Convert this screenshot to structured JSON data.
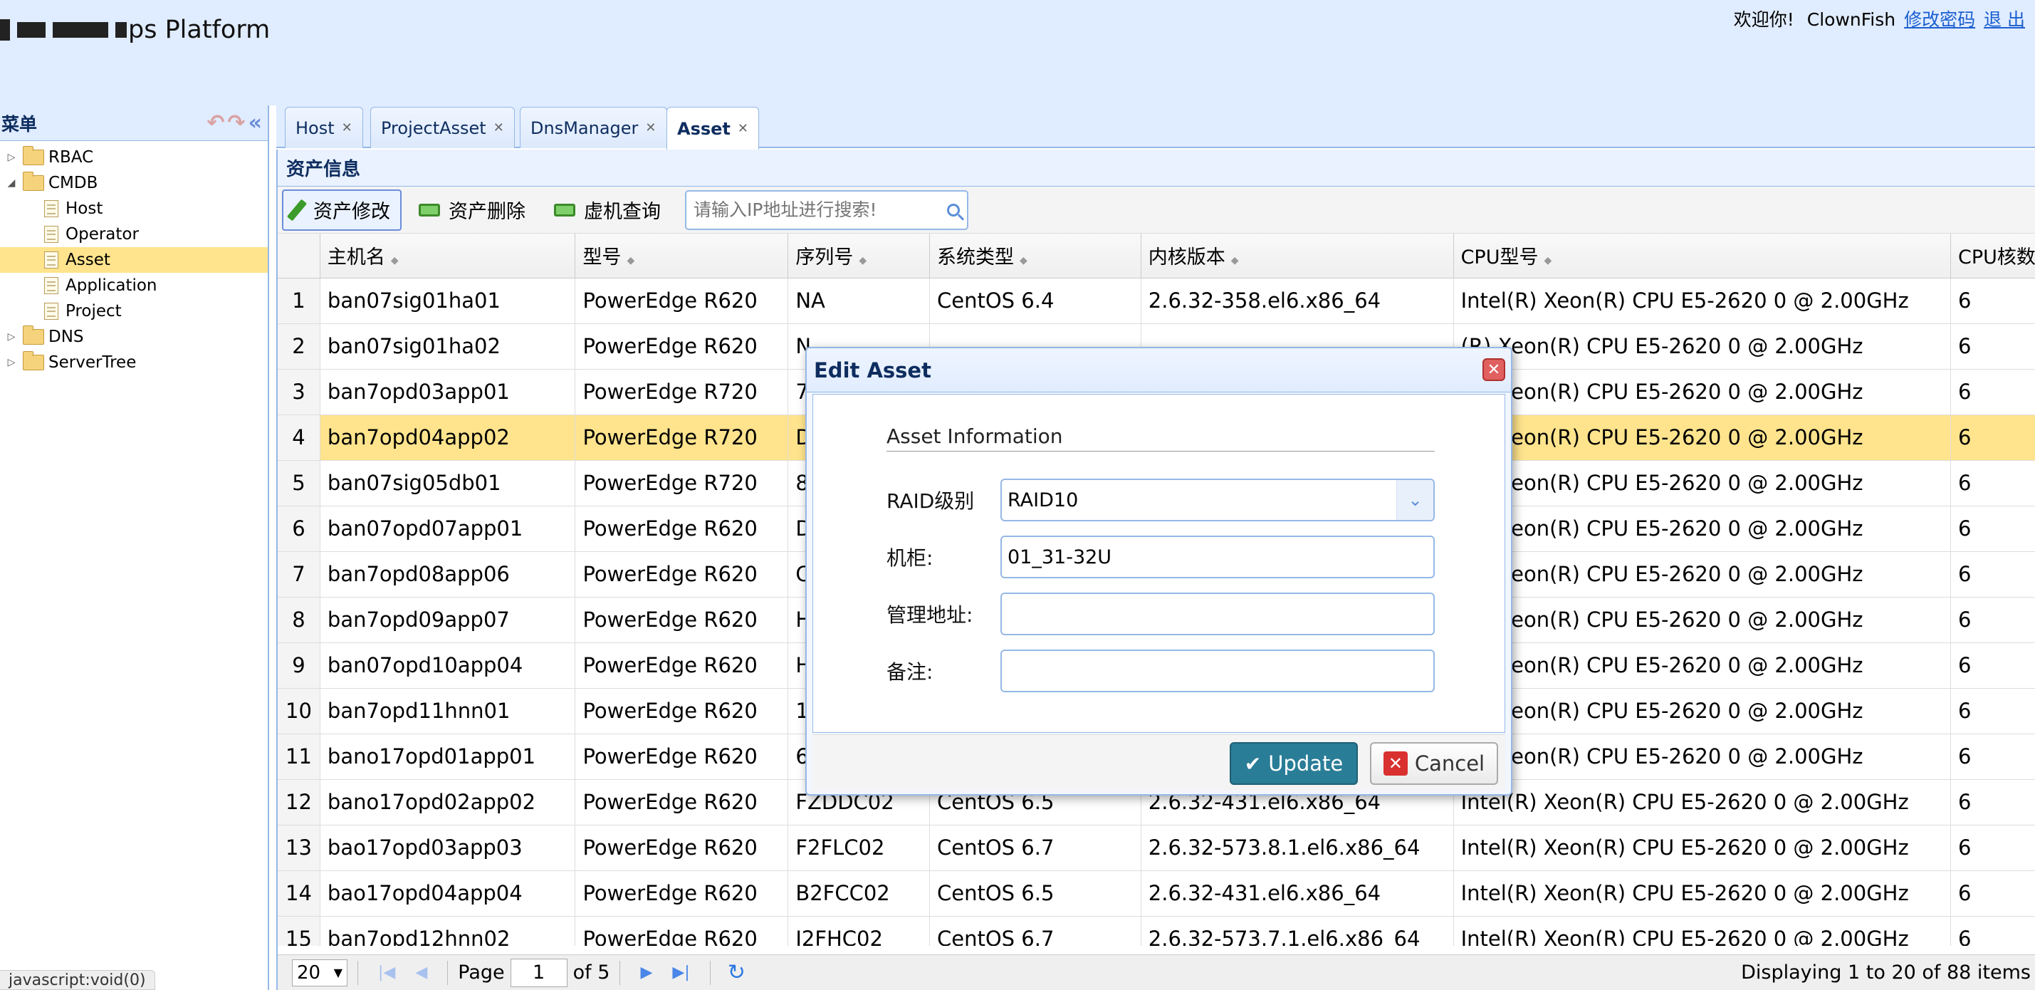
{
  "header": {
    "logo_visible": "ps Platform",
    "welcome": "欢迎你!",
    "username": "ClownFish",
    "change_password": "修改密码",
    "logout": "退 出"
  },
  "menu": {
    "title": "菜单",
    "tree": [
      {
        "label": "RBAC",
        "type": "folder",
        "expanded": false,
        "level": 0
      },
      {
        "label": "CMDB",
        "type": "folder",
        "expanded": true,
        "level": 0
      },
      {
        "label": "Host",
        "type": "file",
        "level": 1
      },
      {
        "label": "Operator",
        "type": "file",
        "level": 1
      },
      {
        "label": "Asset",
        "type": "file",
        "level": 1,
        "selected": true
      },
      {
        "label": "Application",
        "type": "file",
        "level": 1
      },
      {
        "label": "Project",
        "type": "file",
        "level": 1
      },
      {
        "label": "DNS",
        "type": "folder",
        "expanded": false,
        "level": 0
      },
      {
        "label": "ServerTree",
        "type": "folder",
        "expanded": false,
        "level": 0
      }
    ]
  },
  "tabs": [
    {
      "label": "Host",
      "active": false
    },
    {
      "label": "ProjectAsset",
      "active": false
    },
    {
      "label": "DnsManager",
      "active": false
    },
    {
      "label": "Asset",
      "active": true
    }
  ],
  "panel": {
    "title": "资产信息"
  },
  "toolbar": {
    "edit": "资产修改",
    "delete": "资产删除",
    "vm_query": "虚机查询",
    "search_placeholder": "请输入IP地址进行搜索!"
  },
  "table": {
    "columns": [
      "主机名",
      "型号",
      "序列号",
      "系统类型",
      "内核版本",
      "CPU型号",
      "CPU核数"
    ],
    "rows": [
      [
        "1",
        "ban07sig01ha01",
        "PowerEdge R620",
        "NA",
        "CentOS 6.4",
        "2.6.32-358.el6.x86_64",
        "Intel(R) Xeon(R) CPU E5-2620 0 @ 2.00GHz",
        "6"
      ],
      [
        "2",
        "ban07sig01ha02",
        "PowerEdge R620",
        "N",
        "",
        "",
        "(R) Xeon(R) CPU E5-2620 0 @ 2.00GHz",
        "6"
      ],
      [
        "3",
        "ban7opd03app01",
        "PowerEdge R720",
        "7",
        "",
        "",
        "(R) Xeon(R) CPU E5-2620 0 @ 2.00GHz",
        "6"
      ],
      [
        "4",
        "ban7opd04app02",
        "PowerEdge R720",
        "D",
        "",
        "",
        "(R) Xeon(R) CPU E5-2620 0 @ 2.00GHz",
        "6"
      ],
      [
        "5",
        "ban07sig05db01",
        "PowerEdge R720",
        "8",
        "",
        "",
        "(R) Xeon(R) CPU E5-2620 0 @ 2.00GHz",
        "6"
      ],
      [
        "6",
        "ban07opd07app01",
        "PowerEdge R620",
        "D",
        "",
        "",
        "(R) Xeon(R) CPU E5-2620 0 @ 2.00GHz",
        "6"
      ],
      [
        "7",
        "ban7opd08app06",
        "PowerEdge R620",
        "C",
        "",
        "",
        "(R) Xeon(R) CPU E5-2620 0 @ 2.00GHz",
        "6"
      ],
      [
        "8",
        "ban7opd09app07",
        "PowerEdge R620",
        "H",
        "",
        "",
        "(R) Xeon(R) CPU E5-2620 0 @ 2.00GHz",
        "6"
      ],
      [
        "9",
        "ban07opd10app04",
        "PowerEdge R620",
        "H",
        "",
        "",
        "(R) Xeon(R) CPU E5-2620 0 @ 2.00GHz",
        "6"
      ],
      [
        "10",
        "ban7opd11hnn01",
        "PowerEdge R620",
        "1",
        "",
        "",
        "(R) Xeon(R) CPU E5-2620 0 @ 2.00GHz",
        "6"
      ],
      [
        "11",
        "bano17opd01app01",
        "PowerEdge R620",
        "6",
        "",
        "",
        "(R) Xeon(R) CPU E5-2620 0 @ 2.00GHz",
        "6"
      ],
      [
        "12",
        "bano17opd02app02",
        "PowerEdge R620",
        "FZDDC02",
        "CentOS 6.5",
        "2.6.32-431.el6.x86_64",
        "Intel(R) Xeon(R) CPU E5-2620 0 @ 2.00GHz",
        "6"
      ],
      [
        "13",
        "bao17opd03app03",
        "PowerEdge R620",
        "F2FLC02",
        "CentOS 6.7",
        "2.6.32-573.8.1.el6.x86_64",
        "Intel(R) Xeon(R) CPU E5-2620 0 @ 2.00GHz",
        "6"
      ],
      [
        "14",
        "bao17opd04app04",
        "PowerEdge R620",
        "B2FCC02",
        "CentOS 6.5",
        "2.6.32-431.el6.x86_64",
        "Intel(R) Xeon(R) CPU E5-2620 0 @ 2.00GHz",
        "6"
      ],
      [
        "15",
        "ban7opd12hnn02",
        "PowerEdge R620",
        "J2FHC02",
        "CentOS 6.7",
        "2.6.32-573.7.1.el6.x86_64",
        "Intel(R) Xeon(R) CPU E5-2620 0 @ 2.00GHz",
        "6"
      ]
    ],
    "selected_row": 4
  },
  "pager": {
    "page_size": "20",
    "page_label": "Page",
    "page": "1",
    "of_label": "of 5",
    "display": "Displaying 1 to 20 of 88 items"
  },
  "dialog": {
    "title": "Edit Asset",
    "section": "Asset Information",
    "fields": {
      "raid_label": "RAID级别",
      "raid_value": "RAID10",
      "cabinet_label": "机柜:",
      "cabinet_value": "01_31-32U",
      "mgmt_label": "管理地址:",
      "mgmt_value": "",
      "remark_label": "备注:",
      "remark_value": ""
    },
    "update": "Update",
    "cancel": "Cancel"
  },
  "status_bar": "javascript:void(0)",
  "colors": {
    "header_bg": "#e0ecff",
    "border": "#95b8e7",
    "selected_row": "#ffe48d",
    "update_button": "#2a7d97",
    "link": "#1a5fd0"
  }
}
